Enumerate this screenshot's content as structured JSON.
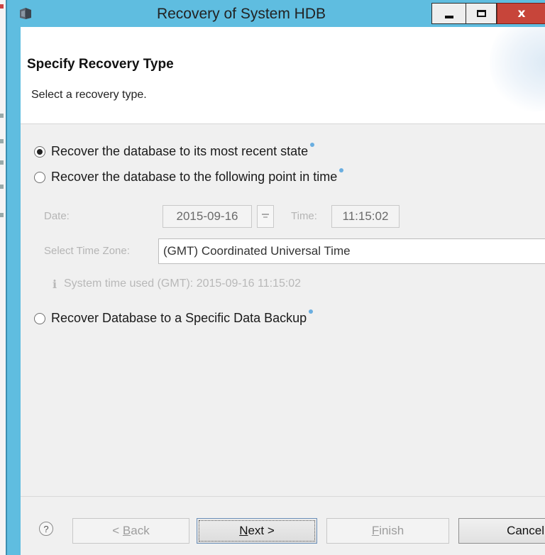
{
  "window": {
    "title": "Recovery of System HDB",
    "close_glyph": "x",
    "accent": "#5fbde0",
    "close_color": "#c7453a"
  },
  "header": {
    "title": "Specify Recovery Type",
    "subtitle": "Select a recovery type."
  },
  "options": {
    "most_recent": {
      "label": "Recover the database to its most recent state",
      "selected": true
    },
    "point_in_time": {
      "label": "Recover the database to the following point in time",
      "selected": false
    },
    "specific_backup": {
      "label": "Recover Database to a Specific Data Backup",
      "selected": false
    }
  },
  "point_in_time": {
    "date_label": "Date:",
    "date_value": "2015-09-16",
    "time_label": "Time:",
    "time_value": "11:15:02",
    "timezone_label": "Select Time Zone:",
    "timezone_value": "(GMT) Coordinated Universal Time",
    "system_time_note": "System time used (GMT): 2015-09-16 11:15:02"
  },
  "footer": {
    "help_glyph": "?",
    "back_prefix": "< ",
    "back_mnemonic": "B",
    "back_rest": "ack",
    "next_mnemonic": "N",
    "next_rest": "ext >",
    "finish_mnemonic": "F",
    "finish_rest": "inish",
    "cancel_label": "Cancel"
  }
}
